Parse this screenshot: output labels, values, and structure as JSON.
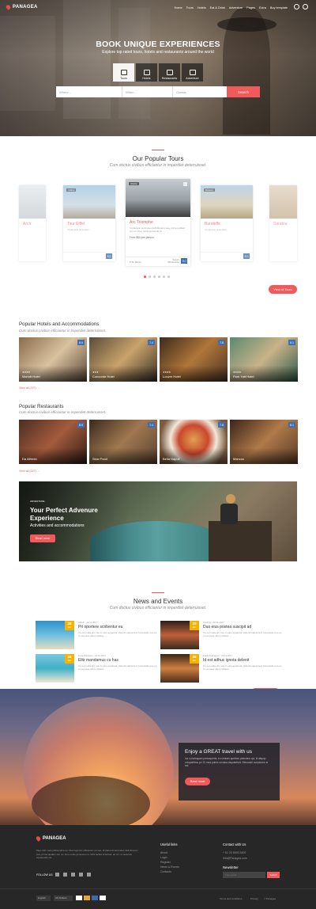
{
  "brand": {
    "name": "PANAGEA",
    "accent": "#f15a5a"
  },
  "nav": [
    "Home",
    "Tours",
    "Hotels",
    "Eat & Drink",
    "Adventure",
    "Pages",
    "Extra",
    "Buy template"
  ],
  "hero": {
    "title": "BOOK UNIQUE EXPERIENCES",
    "subtitle": "Explore top rated tours, hotels and restaurants around the world",
    "categories": [
      "Tours",
      "Hotels",
      "Restaurants",
      "Adventure"
    ],
    "where": "Where...",
    "when": "When...",
    "guests": "Guests",
    "search": "Search"
  },
  "tours": {
    "title": "Our Popular Tours",
    "subtitle": "Cum doctus civibus efficiantur in imperdiet deterruisset.",
    "cards": [
      {
        "name": "Arch",
        "score": "",
        "tag": "",
        "price": ""
      },
      {
        "name": "Tour Eiffel",
        "score": "9.0",
        "tag": "Culture",
        "price": "From $54 /per person"
      },
      {
        "name": "Arc Triomphe",
        "score": "9.0",
        "tag": "Historic",
        "price": "From $54 /per person",
        "desc": "Id placerat tacimates definitionem sea, prima quidam vim no. Duo nobis persecuti cu.",
        "rating": "Superb",
        "reviews": "350 Reviews"
      },
      {
        "name": "Bundeffe",
        "score": "9.0",
        "tag": "Museum",
        "price": "From $54 /per person"
      },
      {
        "name": "Sarabia",
        "score": "9.0",
        "tag": "Walking",
        "price": "From $54 /per person"
      }
    ],
    "more": "View all Tours"
  },
  "hotels": {
    "title": "Popular Hotels and Accommodations",
    "subtitle": "Cum doctus civibus efficiantur in imperdiet deterruisset.",
    "items": [
      {
        "name": "Mariott Hotel",
        "score": "8.9",
        "stars": "★★★★"
      },
      {
        "name": "Concorde Hotel",
        "score": "7.4",
        "stars": "★★★"
      },
      {
        "name": "Louvre Hotel",
        "score": "7.8",
        "stars": "★★★★"
      },
      {
        "name": "Park Yatt Hotel",
        "score": "8.1",
        "stars": "★★★★"
      }
    ],
    "more": "View all (157) →"
  },
  "restaurants": {
    "title": "Popular Restaurants",
    "subtitle": "Cum doctus civibus efficiantur in imperdiet deterruisset.",
    "items": [
      {
        "name": "Da Alfredo",
        "score": "8.9"
      },
      {
        "name": "Slow Food",
        "score": "7.4"
      },
      {
        "name": "Bella Napoli",
        "score": "7.8"
      },
      {
        "name": "Mancus",
        "score": "8.1"
      }
    ],
    "more": "View all (157) →"
  },
  "adventure": {
    "kicker": "ADVENTURE",
    "title": "Your Perfect Advenure Experience",
    "subtitle": "Activities and accommodations",
    "btn": "Read more"
  },
  "news": {
    "title": "News and Events",
    "subtitle": "Cum doctus civibus efficiantur in imperdiet deterruisset.",
    "items": [
      {
        "day": "28",
        "mon": "Dec",
        "meta": "Admin - 20.11.2017",
        "title": "Pri oportere scribentur eu",
        "desc": "Cu eum alia elit, usu in eius appareat, deleniti sapientem honestatis eos ex. In ius esse ullum vidisse..."
      },
      {
        "day": "28",
        "mon": "Dec",
        "meta": "Cooking - 20.11.2017",
        "title": "Duo eius postea suscipit ad",
        "desc": "Cu eum alia elit, usu in eius appareat, deleniti sapientem honestatis eos ex. In ius esse ullum vidisse..."
      },
      {
        "day": "28",
        "mon": "Dec",
        "meta": "Luca Robinson - 20.11.2017",
        "title": "Elitr mandamus cu has",
        "desc": "Cu eum alia elit, usu in eius appareat, deleniti sapientem honestatis eos ex. In ius esse ullum vidisse..."
      },
      {
        "day": "28",
        "mon": "Dec",
        "meta": "Paula Rodriguez - 20.11.2017",
        "title": "Id est adhuc ignota delenit",
        "desc": "Cu eum alia elit, usu in eius appareat, deleniti sapientem honestatis eos ex. In ius esse ullum vidisse..."
      }
    ],
    "more": "View all news"
  },
  "promo": {
    "title": "Enjoy a GREAT travel with us",
    "desc": "Ius cu tamquam persequeris, eu veniam apeirian platonem qui, id aliquip voluptatibus pri. Ei mea primis ornatus disputationi. Menandri scriptorem ei est.",
    "btn": "Read more"
  },
  "footer": {
    "about": "Mea nibh meis philosophia eu. Duis legimus efficiantur ea sea. Id placerat tacimates definitionem sea, prima quidam vim no. Duo nobis persecuti cu. Nihil facilisi indoctum an vix, ut delectus expetendis vis.",
    "follow": "FOLLOW US",
    "links_h": "Useful links",
    "links": [
      "About",
      "Login",
      "Register",
      "News & Events",
      "Contacts"
    ],
    "contact_h": "Contact with Us",
    "phone": "+ 61 23 8093 3400",
    "email": "info@Panagea.com",
    "news_h": "Newsletter",
    "news_ph": "Your email",
    "submit": "Submit",
    "lang": "English",
    "cur": "US Dollars",
    "legal": [
      "Terms and conditions",
      "Privacy",
      "© Panagea"
    ]
  }
}
